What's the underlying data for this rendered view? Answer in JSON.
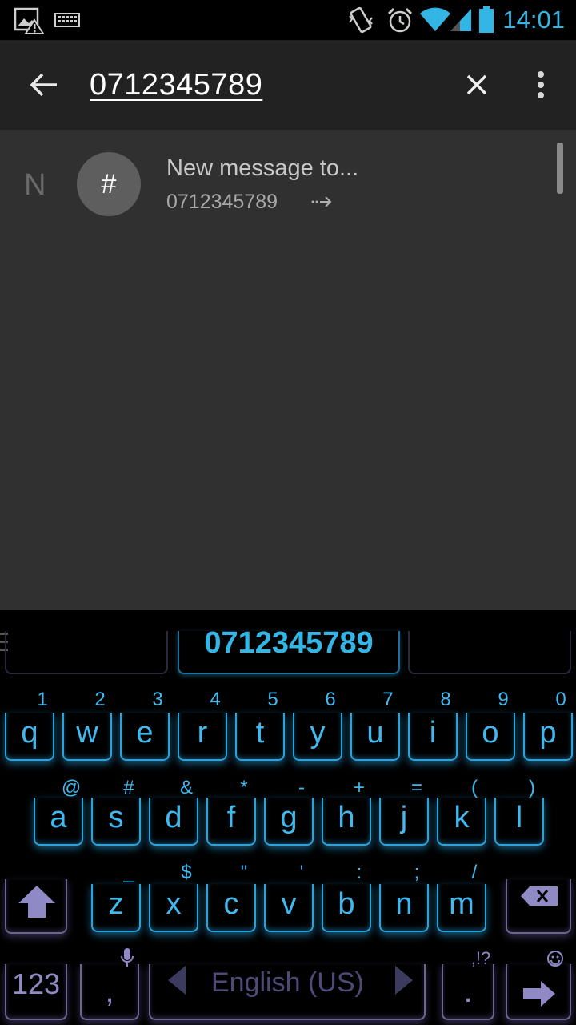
{
  "status_bar": {
    "time": "14:01",
    "icons": [
      "image-warning-icon",
      "keyboard-icon",
      "vibrate-icon",
      "alarm-icon",
      "wifi-icon",
      "cell-signal-icon",
      "battery-icon"
    ],
    "accent_color": "#33b5e5"
  },
  "action_bar": {
    "search_query": "0712345789",
    "icons": [
      "back-arrow-icon",
      "clear-icon",
      "overflow-menu-icon"
    ]
  },
  "results": {
    "index_letter": "N",
    "avatar_symbol": "#",
    "title": "New message to...",
    "number": "0712345789",
    "icons": [
      "forward-arrow-icon"
    ]
  },
  "keyboard": {
    "suggestion": "0712345789",
    "row1": [
      {
        "key": "q",
        "hint": "1"
      },
      {
        "key": "w",
        "hint": "2"
      },
      {
        "key": "e",
        "hint": "3"
      },
      {
        "key": "r",
        "hint": "4"
      },
      {
        "key": "t",
        "hint": "5"
      },
      {
        "key": "y",
        "hint": "6"
      },
      {
        "key": "u",
        "hint": "7"
      },
      {
        "key": "i",
        "hint": "8"
      },
      {
        "key": "o",
        "hint": "9"
      },
      {
        "key": "p",
        "hint": "0"
      }
    ],
    "row2": [
      {
        "key": "a",
        "hint": "@"
      },
      {
        "key": "s",
        "hint": "#"
      },
      {
        "key": "d",
        "hint": "&"
      },
      {
        "key": "f",
        "hint": "*"
      },
      {
        "key": "g",
        "hint": "-"
      },
      {
        "key": "h",
        "hint": "+"
      },
      {
        "key": "j",
        "hint": "="
      },
      {
        "key": "k",
        "hint": "("
      },
      {
        "key": "l",
        "hint": ")"
      }
    ],
    "row3": [
      {
        "key": "z",
        "hint": "_"
      },
      {
        "key": "x",
        "hint": "$"
      },
      {
        "key": "c",
        "hint": "\""
      },
      {
        "key": "v",
        "hint": "'"
      },
      {
        "key": "b",
        "hint": ":"
      },
      {
        "key": "n",
        "hint": ";"
      },
      {
        "key": "m",
        "hint": "/"
      }
    ],
    "row4": {
      "symbols_key": "123",
      "comma_key": ",",
      "language": "English (US)",
      "period_key": ".",
      "period_hint": ",!?"
    },
    "icons": [
      "shift-icon",
      "backspace-icon",
      "mic-icon",
      "smiley-icon",
      "enter-arrow-icon",
      "lang-prev-icon",
      "lang-next-icon",
      "menu-icon"
    ],
    "key_color": "#3fb9ef",
    "function_key_color": "#8f89c6"
  }
}
